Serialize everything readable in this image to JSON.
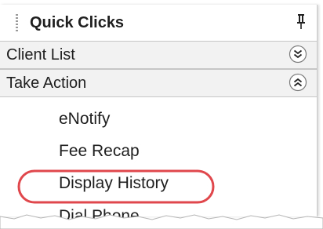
{
  "panel": {
    "title": "Quick Clicks",
    "pin_icon": "pin-icon"
  },
  "sections": [
    {
      "label": "Client List",
      "state": "collapsed",
      "icon": "chevron-double-down-icon"
    },
    {
      "label": "Take Action",
      "state": "expanded",
      "icon": "chevron-double-up-icon"
    }
  ],
  "take_action_items": [
    {
      "label": "eNotify"
    },
    {
      "label": "Fee Recap"
    },
    {
      "label": "Display History",
      "highlighted": true
    },
    {
      "label": "Dial Phone"
    }
  ],
  "colors": {
    "highlight": "#e0474c",
    "section_bg": "#f2f2f2",
    "text": "#1e1e1e"
  }
}
